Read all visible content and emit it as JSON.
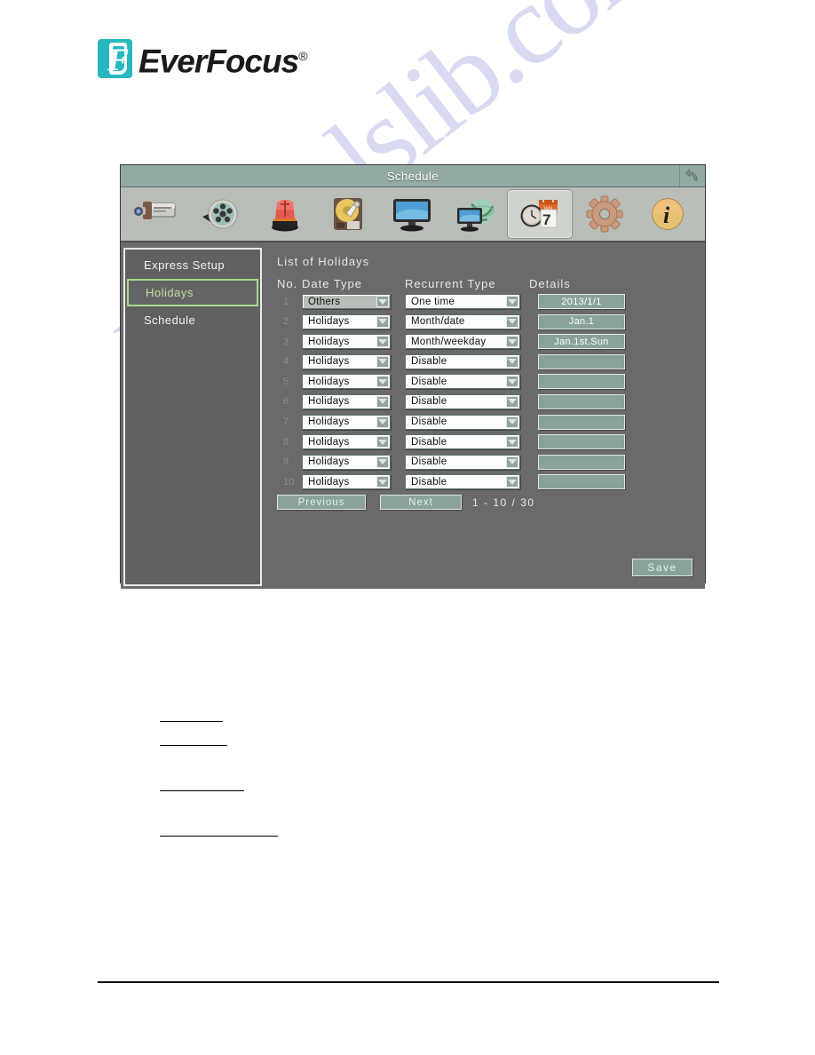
{
  "brand": {
    "name": "EverFocus",
    "registered": "®",
    "mark_letter": "F"
  },
  "window": {
    "title": "Schedule",
    "back_icon": "back-arrow-icon"
  },
  "toolbar": {
    "items": [
      {
        "name": "camera-icon",
        "label": "Camera",
        "selected": false
      },
      {
        "name": "film-reel-icon",
        "label": "Record",
        "selected": false
      },
      {
        "name": "alarm-light-icon",
        "label": "Alarm",
        "selected": false
      },
      {
        "name": "hard-disk-icon",
        "label": "Disk",
        "selected": false
      },
      {
        "name": "monitor-icon",
        "label": "Display",
        "selected": false
      },
      {
        "name": "network-globe-icon",
        "label": "Network",
        "selected": false
      },
      {
        "name": "clock-calendar-icon",
        "label": "Schedule",
        "selected": true
      },
      {
        "name": "gear-icon",
        "label": "System",
        "selected": false
      },
      {
        "name": "info-icon",
        "label": "Information",
        "selected": false
      }
    ]
  },
  "sidebar": {
    "items": [
      {
        "label": "Express Setup",
        "active": false
      },
      {
        "label": "Holidays",
        "active": true
      },
      {
        "label": "Schedule",
        "active": false
      }
    ]
  },
  "main": {
    "section_title": "List of Holidays",
    "columns": {
      "no": "No.",
      "date_type": "Date Type",
      "recurrent_type": "Recurrent Type",
      "details": "Details"
    },
    "rows": [
      {
        "no": "1",
        "date_type": "Others",
        "recurrent_type": "One time",
        "details": "2013/1/1",
        "focused": true
      },
      {
        "no": "2",
        "date_type": "Holidays",
        "recurrent_type": "Month/date",
        "details": "Jan.1",
        "focused": false
      },
      {
        "no": "3",
        "date_type": "Holidays",
        "recurrent_type": "Month/weekday",
        "details": "Jan.1st.Sun",
        "focused": false
      },
      {
        "no": "4",
        "date_type": "Holidays",
        "recurrent_type": "Disable",
        "details": "",
        "focused": false
      },
      {
        "no": "5",
        "date_type": "Holidays",
        "recurrent_type": "Disable",
        "details": "",
        "focused": false
      },
      {
        "no": "6",
        "date_type": "Holidays",
        "recurrent_type": "Disable",
        "details": "",
        "focused": false
      },
      {
        "no": "7",
        "date_type": "Holidays",
        "recurrent_type": "Disable",
        "details": "",
        "focused": false
      },
      {
        "no": "8",
        "date_type": "Holidays",
        "recurrent_type": "Disable",
        "details": "",
        "focused": false
      },
      {
        "no": "9",
        "date_type": "Holidays",
        "recurrent_type": "Disable",
        "details": "",
        "focused": false
      },
      {
        "no": "10",
        "date_type": "Holidays",
        "recurrent_type": "Disable",
        "details": "",
        "focused": false
      }
    ],
    "pager": {
      "previous": "Previous",
      "next": "Next",
      "range": "1 - 10 / 30"
    },
    "save_label": "Save"
  },
  "watermark": {
    "text": "manualslib.com"
  },
  "colors": {
    "panel_bg": "#6a6a6a",
    "titlebar": "#93a9a3",
    "toolbar": "#b9bdb8",
    "accent_green": "#a9d98c",
    "button_teal": "#89a29b",
    "brand_teal": "#27b8bf"
  }
}
